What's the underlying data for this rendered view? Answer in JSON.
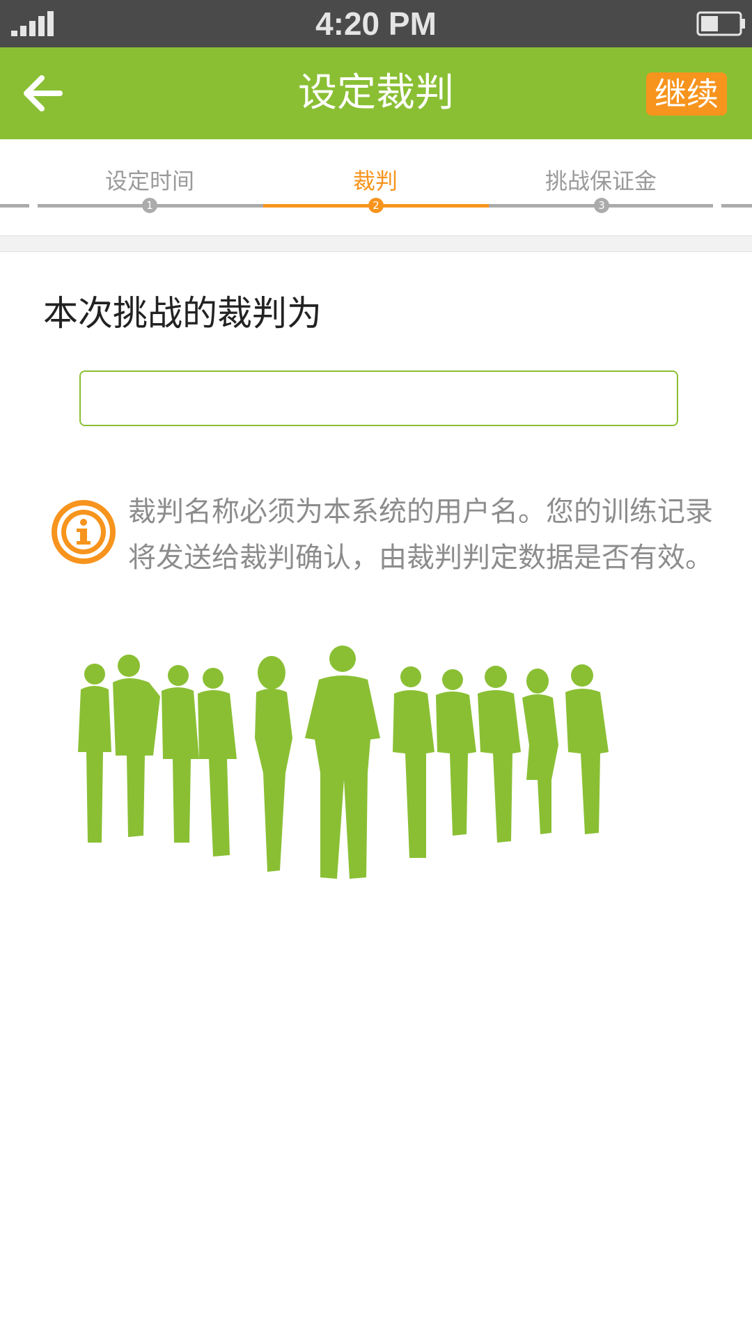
{
  "status_bar": {
    "time": "4:20 PM",
    "signal_icon": "signal-bars-icon",
    "battery_icon": "battery-icon"
  },
  "header": {
    "back_icon": "arrow-left-icon",
    "title": "设定裁判",
    "continue_label": "继续",
    "background_color": "#8abf34",
    "button_color": "#f7941d"
  },
  "stepper": {
    "steps": [
      {
        "label": "设定时间",
        "number": "1",
        "active": false
      },
      {
        "label": "裁判",
        "number": "2",
        "active": true
      },
      {
        "label": "挑战保证金",
        "number": "3",
        "active": false
      }
    ],
    "active_color": "#f7941d",
    "inactive_color": "#ababab"
  },
  "main": {
    "section_title": "本次挑战的裁判为",
    "referee_input": {
      "value": "",
      "placeholder": ""
    },
    "info_icon": "info-circle-icon",
    "info_text": "裁判名称必须为本系统的用户名。您的训练记录将发送给裁判确认，由裁判判定数据是否有效。",
    "illustration": "people-silhouettes-illustration",
    "illustration_color": "#8abf34"
  }
}
